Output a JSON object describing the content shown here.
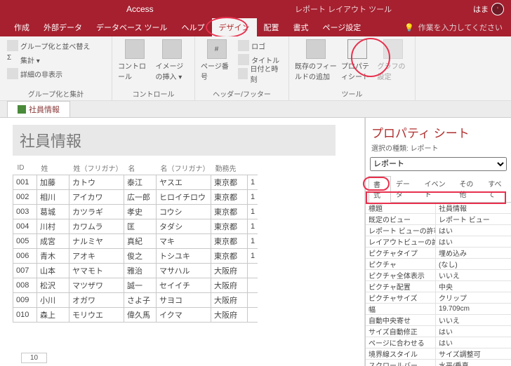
{
  "title": {
    "app": "Access",
    "tool": "レポート レイアウト ツール",
    "user": "はま"
  },
  "menu": {
    "items": [
      "作成",
      "外部データ",
      "データベース ツール",
      "ヘルプ",
      "デザイン",
      "配置",
      "書式",
      "ページ設定"
    ],
    "active": 4,
    "tell_placeholder": "作業を入力してください"
  },
  "ribbon": {
    "g1": {
      "label": "グループ化と集計",
      "i1": "グループ化と並べ替え",
      "i2": "集計 ▾",
      "i3": "詳細の非表示"
    },
    "g2": {
      "label": "コントロール",
      "b1": "コントロール",
      "b2": "イメージの挿入 ▾"
    },
    "g3": {
      "label": "ヘッダー/フッター",
      "b1": "ページ番号",
      "i1": "ロゴ",
      "i2": "タイトル",
      "i3": "日付と時刻"
    },
    "g4": {
      "label": "ツール",
      "b1": "既存のフィールドの追加",
      "b2": "プロパティシート",
      "b3": "グラフの設定"
    }
  },
  "doc_tab": "社員情報",
  "report": {
    "title": "社員情報",
    "cols": [
      "ID",
      "姓",
      "姓（フリガナ）",
      "名",
      "名（フリガナ）",
      "勤務先"
    ],
    "rows": [
      [
        "001",
        "加藤",
        "カトウ",
        "泰江",
        "ヤスエ",
        "東京都",
        "1"
      ],
      [
        "002",
        "相川",
        "アイカワ",
        "広一郎",
        "ヒロイチロウ",
        "東京都",
        "1"
      ],
      [
        "003",
        "葛城",
        "カツラギ",
        "孝史",
        "コウシ",
        "東京都",
        "1"
      ],
      [
        "004",
        "川村",
        "カワムラ",
        "匡",
        "タダシ",
        "東京都",
        "1"
      ],
      [
        "005",
        "成宮",
        "ナルミヤ",
        "真紀",
        "マキ",
        "東京都",
        "1"
      ],
      [
        "006",
        "青木",
        "アオキ",
        "俊之",
        "トシユキ",
        "東京都",
        "1"
      ],
      [
        "007",
        "山本",
        "ヤマモト",
        "雅治",
        "マサハル",
        "大阪府",
        ""
      ],
      [
        "008",
        "松沢",
        "マツザワ",
        "誠一",
        "セイイチ",
        "大阪府",
        ""
      ],
      [
        "009",
        "小川",
        "オガワ",
        "さよ子",
        "サヨコ",
        "大阪府",
        ""
      ],
      [
        "010",
        "森上",
        "モリウエ",
        "偉久馬",
        "イクマ",
        "大阪府",
        ""
      ]
    ],
    "footer_count": "10"
  },
  "prop": {
    "title": "プロパティ シート",
    "sub": "選択の種類: レポート",
    "selected": "レポート",
    "tabs": [
      "書式",
      "データ",
      "イベント",
      "その他",
      "すべて"
    ],
    "active_tab": 0,
    "rows": [
      [
        "標題",
        "社員情報"
      ],
      [
        "既定のビュー",
        "レポート ビュー"
      ],
      [
        "レポート ビューの許可",
        "はい"
      ],
      [
        "レイアウトビューの許可",
        "はい"
      ],
      [
        "ピクチャタイプ",
        "埋め込み"
      ],
      [
        "ピクチャ",
        "(なし)"
      ],
      [
        "ピクチャ全体表示",
        "いいえ"
      ],
      [
        "ピクチャ配置",
        "中央"
      ],
      [
        "ピクチャサイズ",
        "クリップ"
      ],
      [
        "幅",
        "19.709cm"
      ],
      [
        "自動中央寄せ",
        "いいえ"
      ],
      [
        "サイズ自動修正",
        "はい"
      ],
      [
        "ページに合わせる",
        "はい"
      ],
      [
        "境界線スタイル",
        "サイズ調整可"
      ],
      [
        "スクロールバー",
        "水平/垂直"
      ]
    ]
  }
}
